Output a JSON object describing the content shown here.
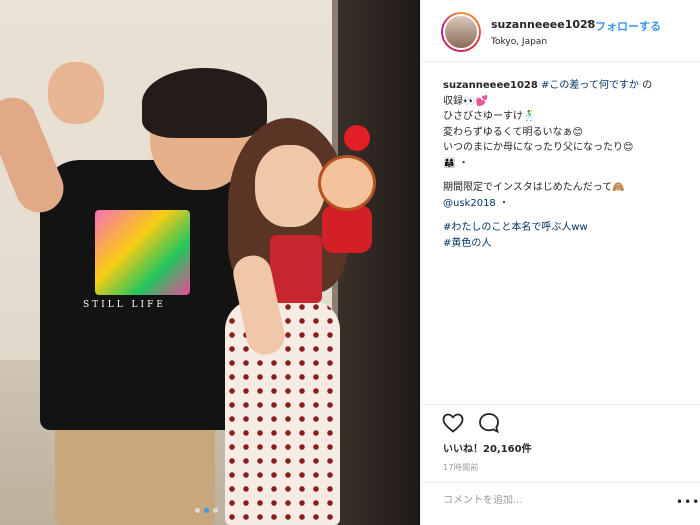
{
  "post": {
    "username": "suzanneeee1028",
    "separator": "•",
    "follow_label": "フォローする",
    "location": "Tokyo, Japan"
  },
  "caption": {
    "username": "suzanneeee1028",
    "line1_tag": "#この差って何ですか",
    "line1_rest": " の",
    "line2": "収録👀💕",
    "line3": "ひさびさゆーすけ🕺",
    "line4": "変わらずゆるくて明るいなぁ😊",
    "line5": "いつのまにか母になったり父になったり😊",
    "line6": "👨‍👩‍👧 ・",
    "line7": "期間限定でインスタはじめたんだって🙈",
    "line8_mention": "@usk2018",
    "line8_rest": " ・",
    "line9_tag": "#わたしのこと本名で呼ぶ人ww",
    "line10_tag": "#黄色の人"
  },
  "photo": {
    "shirt_print": "STILL LIFE",
    "carousel_dots": 3,
    "active_dot": 2
  },
  "actions": {
    "likes": "いいね！20,160件",
    "time": "17時間前"
  },
  "comment_box": {
    "placeholder": "コメントを追加...",
    "more": "•••"
  },
  "colors": {
    "link": "#3897f0",
    "hashtag": "#003569",
    "text": "#262626",
    "muted": "#999999"
  }
}
